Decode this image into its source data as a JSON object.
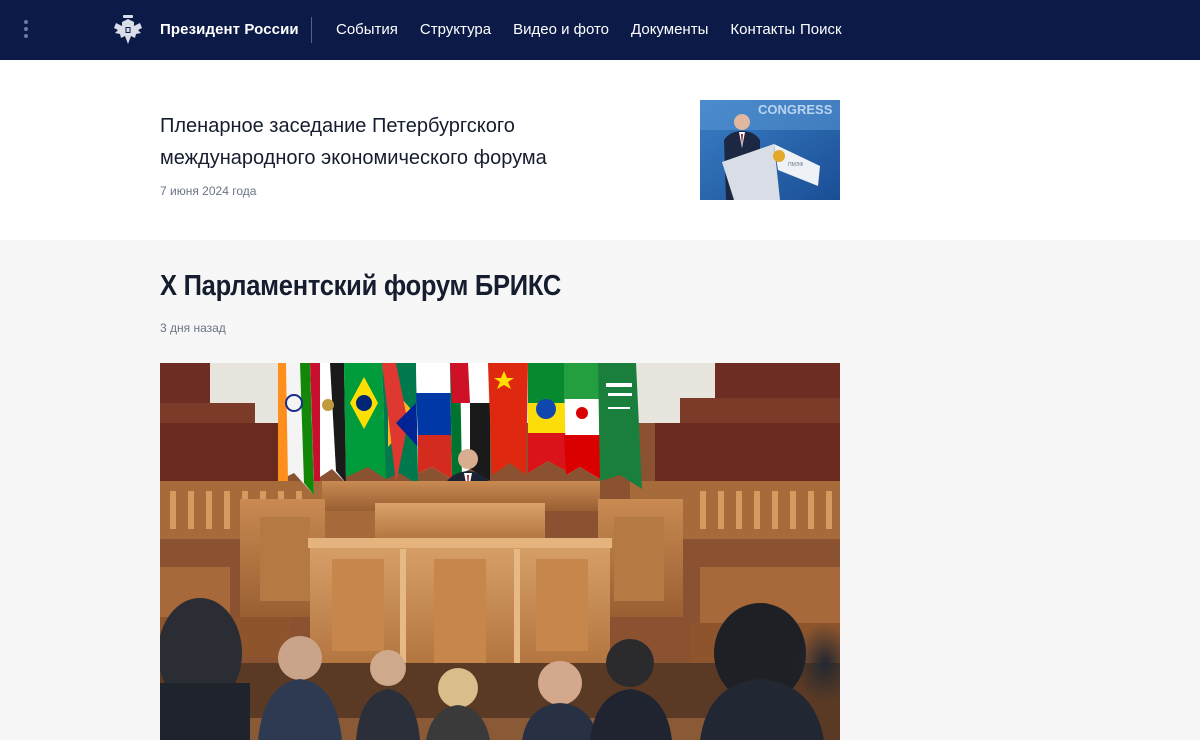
{
  "header": {
    "site_title": "Президент России",
    "nav": [
      "События",
      "Структура",
      "Видео и фото",
      "Документы",
      "Контакты"
    ],
    "search": "Поиск",
    "background_color": "#0b1a46",
    "icons": {
      "menu": "vertical-dots-icon",
      "logo": "double-headed-eagle-emblem"
    }
  },
  "articles": [
    {
      "title": "Пленарное заседание Петербургского международного экономического форума",
      "date": "7 июня 2024 года",
      "image_text": "CONGRESS"
    },
    {
      "title": "X Парламентский форум БРИКС",
      "date": "3 дня назад"
    }
  ]
}
